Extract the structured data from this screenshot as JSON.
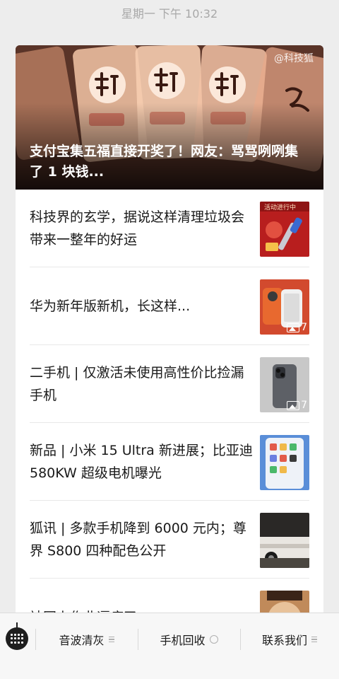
{
  "status": {
    "timestamp": "星期一 下午 10:32"
  },
  "cover": {
    "watermark": "@科技狐",
    "title": "支付宝集五福直接开奖了！网友：骂骂咧咧集了 1 块钱..."
  },
  "articles": [
    {
      "title": "科技界的玄学，据说这样清理垃圾会带来一整年的好运",
      "thumb_label": "活动进行中",
      "photo_count": ""
    },
    {
      "title": "华为新年版新机，长这样...",
      "thumb_label": "",
      "photo_count": "7"
    },
    {
      "title": "二手机 | 仅激活未使用高性价比捡漏手机",
      "thumb_label": "",
      "photo_count": "7"
    },
    {
      "title": "新品 | 小米 15 Ultra 新进展；比亚迪 580KW 超级电机曝光",
      "thumb_label": "",
      "photo_count": ""
    },
    {
      "title": "狐讯 | 多款手机降到 6000 元内；尊界 S800 四种配色公开",
      "thumb_label": "",
      "photo_count": ""
    },
    {
      "title": "被网上作业逼疯了...",
      "thumb_label": "",
      "photo_count": ""
    }
  ],
  "toolbar": {
    "keyboard_icon": "keyboard-icon",
    "menu1": "音波清灰",
    "menu2": "手机回收",
    "menu3": "联系我们"
  },
  "colors": {
    "background": "#ededed",
    "card": "#ffffff",
    "text": "#1a1a1a",
    "muted": "#a8a8a8"
  }
}
